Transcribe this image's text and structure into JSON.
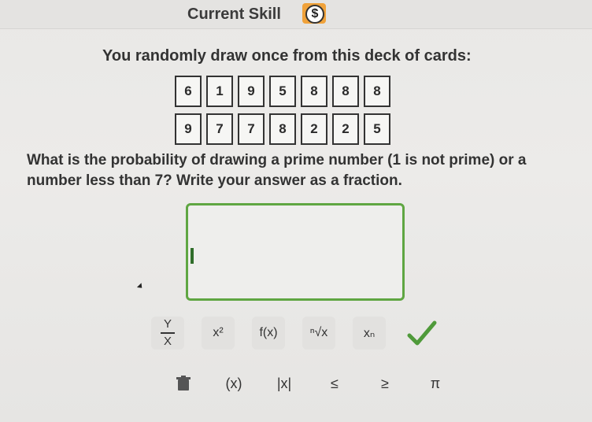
{
  "header": {
    "title": "Current Skill",
    "badge_symbol": "$",
    "badge_color": "#f0a23a"
  },
  "problem": {
    "prompt": "You randomly draw once from this deck of cards:",
    "deck": {
      "row1": [
        "6",
        "1",
        "9",
        "5",
        "8",
        "8",
        "8"
      ],
      "row2": [
        "9",
        "7",
        "7",
        "8",
        "2",
        "2",
        "5"
      ]
    },
    "question": "What is the probability of drawing a prime number (1 is not prime) or a number less than 7? Write your answer as a fraction."
  },
  "answer": {
    "value": "",
    "border_color": "#5fa642"
  },
  "toolbar": {
    "row1": [
      {
        "name": "fraction-button",
        "num": "Y",
        "den": "X"
      },
      {
        "name": "exponent-button",
        "label": "x²"
      },
      {
        "name": "function-button",
        "label": "f(x)"
      },
      {
        "name": "nth-root-button",
        "label": "ⁿ√x"
      },
      {
        "name": "subscript-button",
        "label": "xₙ"
      }
    ],
    "row2": [
      {
        "name": "parentheses-button",
        "label": "(x)"
      },
      {
        "name": "absolute-value-button",
        "label": "|x|"
      },
      {
        "name": "less-equal-button",
        "label": "≤"
      },
      {
        "name": "greater-equal-button",
        "label": "≥"
      },
      {
        "name": "pi-button",
        "label": "π"
      }
    ],
    "check_color": "#4f9a3a"
  }
}
